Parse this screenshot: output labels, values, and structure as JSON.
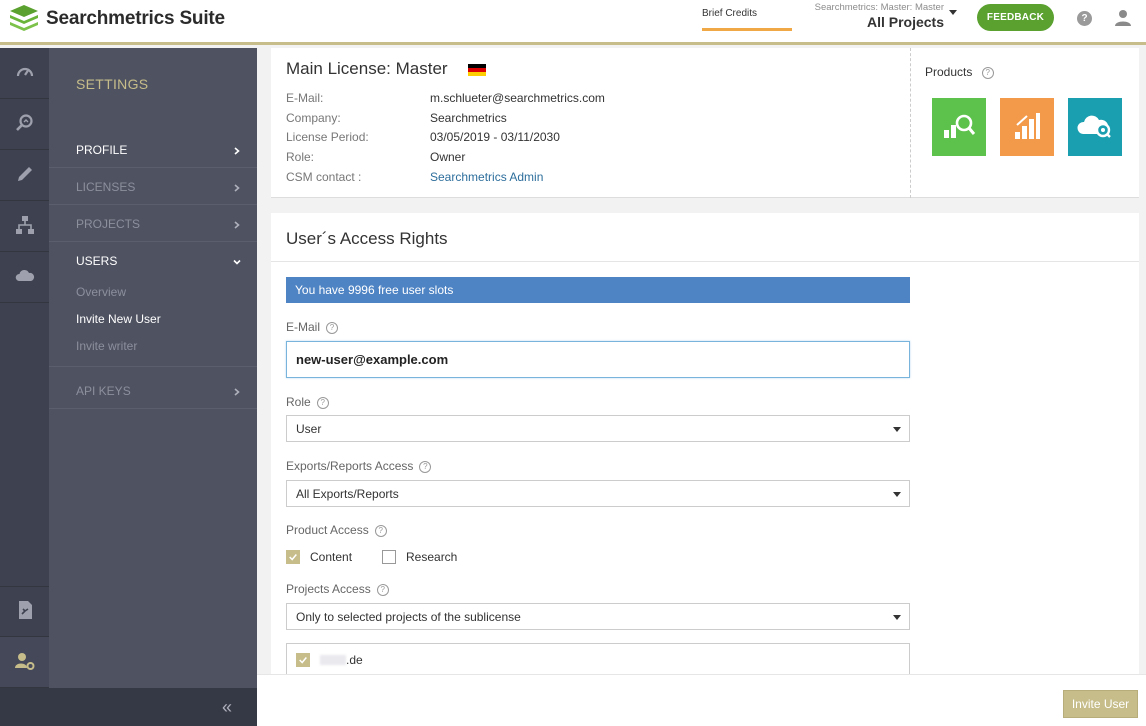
{
  "header": {
    "app_name": "Searchmetrics Suite",
    "credits_label": "Brief Credits",
    "project_context": "Searchmetrics: Master: Master",
    "project_selected": "All Projects",
    "feedback_label": "FEEDBACK",
    "help_label": "?"
  },
  "rail": {
    "items": [
      "dashboard-icon",
      "research-icon",
      "content-icon",
      "structure-icon",
      "cloud-icon",
      "reports-icon",
      "user-settings-icon"
    ]
  },
  "settings": {
    "title": "SETTINGS",
    "nav": [
      {
        "label": "PROFILE"
      },
      {
        "label": "LICENSES"
      },
      {
        "label": "PROJECTS"
      },
      {
        "label": "USERS"
      },
      {
        "label": "API KEYS"
      }
    ],
    "users_sub": [
      "Overview",
      "Invite New User",
      "Invite writer"
    ],
    "collapse_label": "«"
  },
  "license": {
    "title": "Main License: Master",
    "rows": [
      {
        "label": "E-Mail:",
        "value": "m.schlueter@searchmetrics.com"
      },
      {
        "label": "Company:",
        "value": "Searchmetrics"
      },
      {
        "label": "License Period:",
        "value": "03/05/2019 - 03/11/2030"
      },
      {
        "label": "Role:",
        "value": "Owner"
      },
      {
        "label": "CSM contact :",
        "value": "Searchmetrics Admin"
      }
    ],
    "products_label": "Products",
    "help_glyph": "?",
    "colors": {
      "green": "#5cc24b",
      "orange": "#f29a4a",
      "teal": "#1a9fb0"
    }
  },
  "access": {
    "title": "User´s Access Rights",
    "banner": "You have 9996 free user slots",
    "email_label": "E-Mail",
    "email_value": "new-user@example.com",
    "role_label": "Role",
    "role_value": "User",
    "exports_label": "Exports/Reports Access",
    "exports_value": "All Exports/Reports",
    "product_label": "Product Access",
    "product_options": [
      {
        "label": "Content",
        "checked": true
      },
      {
        "label": "Research",
        "checked": false
      }
    ],
    "projects_label": "Projects Access",
    "projects_value": "Only to selected projects of the sublicense",
    "project_item": ".de"
  },
  "footer": {
    "invite_label": "Invite User"
  }
}
